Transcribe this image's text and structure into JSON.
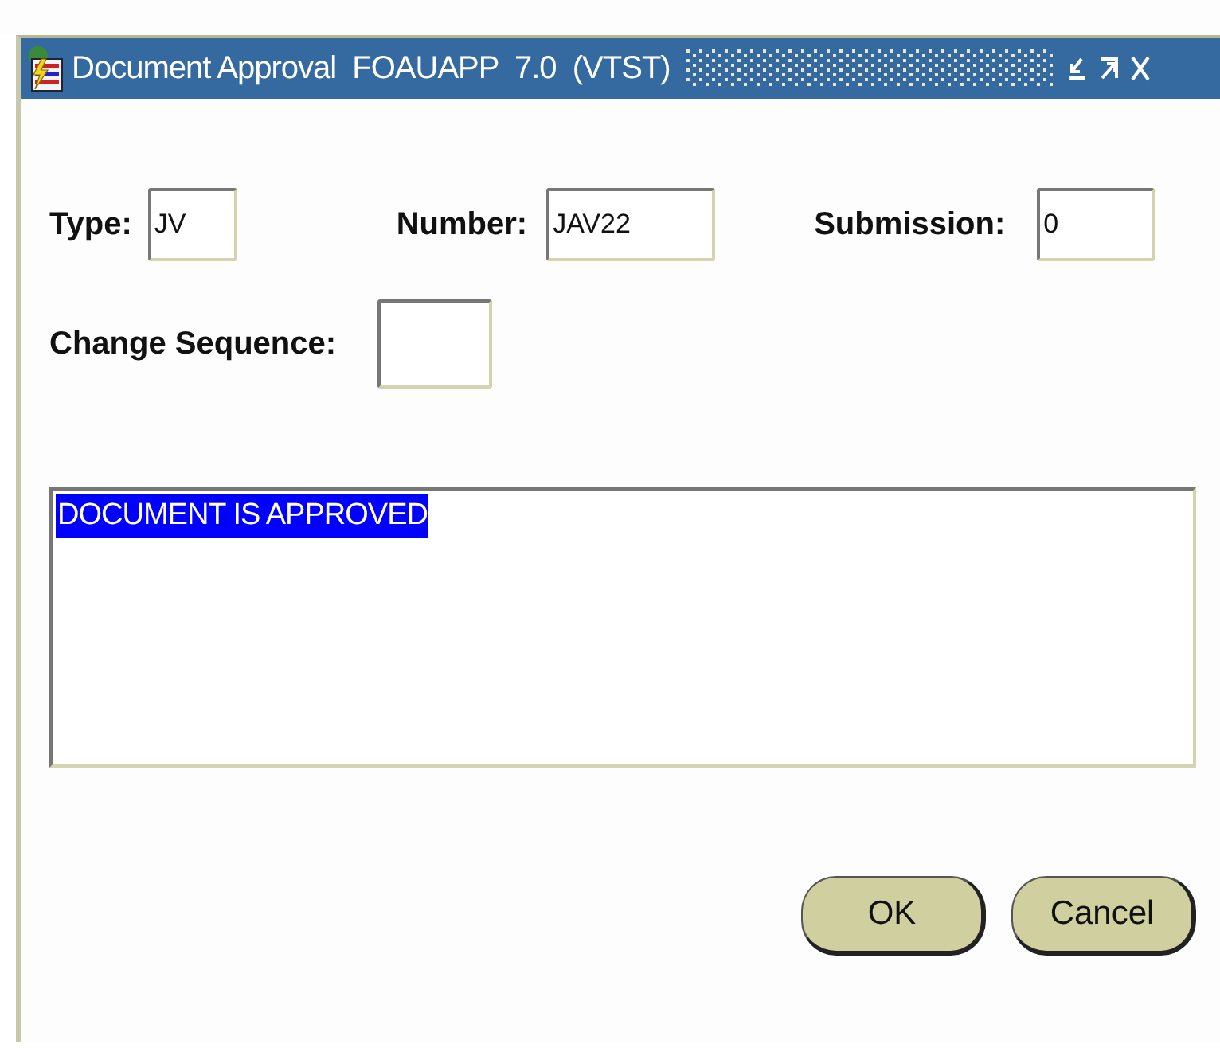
{
  "window": {
    "title": "Document Approval  FOAUAPP  7.0  (VTST)"
  },
  "fields": [
    {
      "label": "Type:",
      "value": "JV"
    },
    {
      "label": "Number:",
      "value": "JAV22"
    },
    {
      "label": "Submission:",
      "value": "0"
    }
  ],
  "change_sequence": {
    "label": "Change Sequence:"
  },
  "message": {
    "text": "DOCUMENT IS APPROVED",
    "highlighted": true
  },
  "buttons": [
    "OK",
    "Cancel"
  ]
}
